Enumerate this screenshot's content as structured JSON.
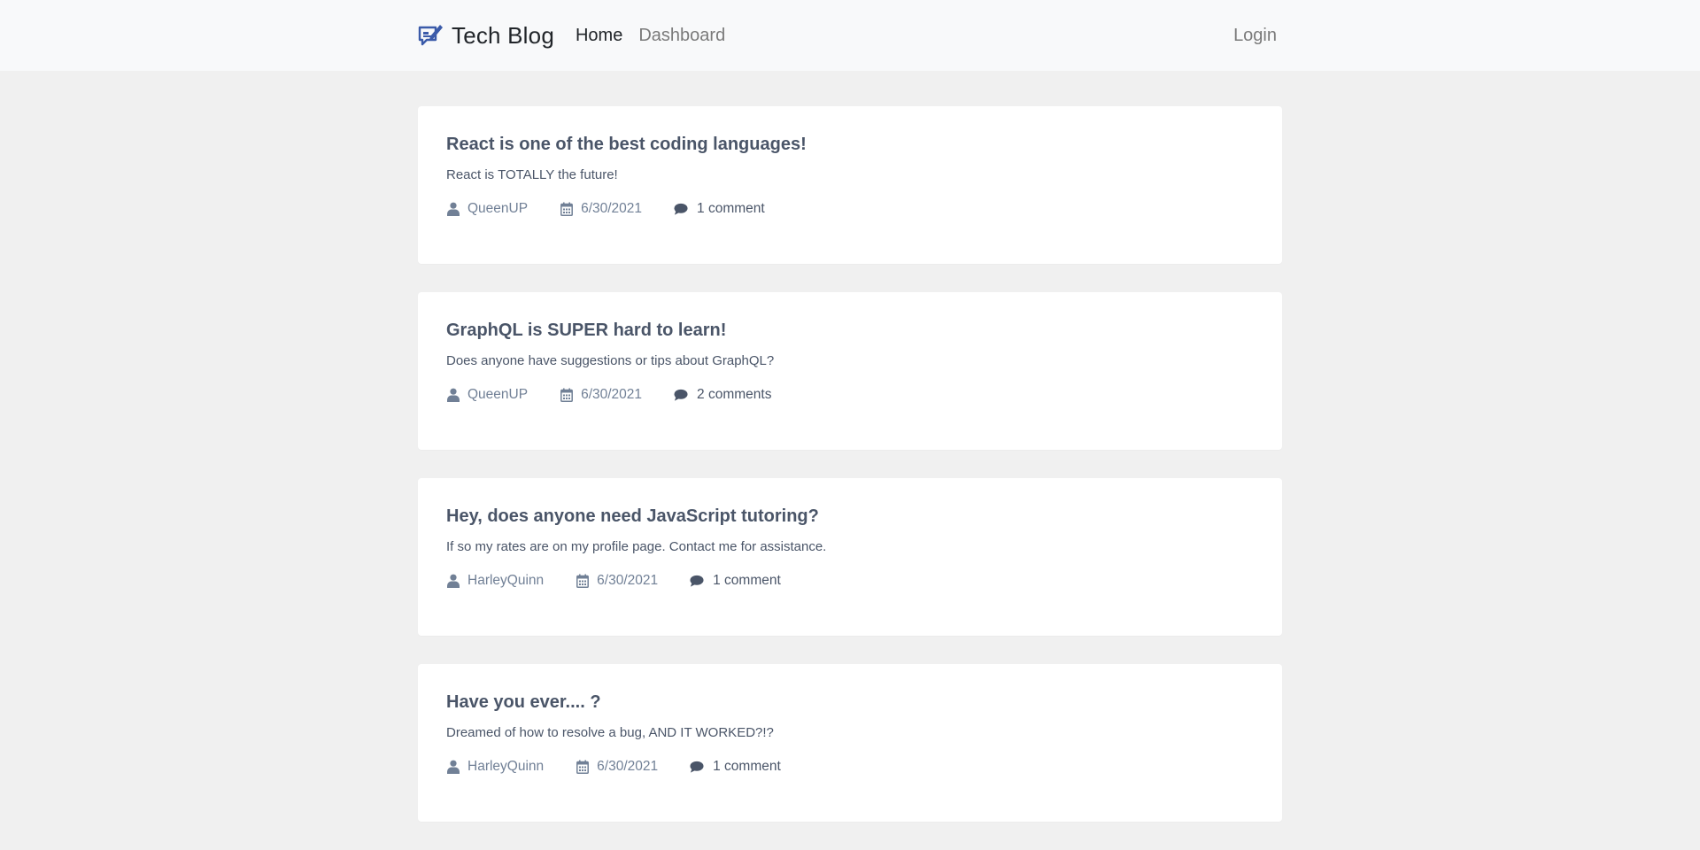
{
  "navbar": {
    "brand_title": "Tech Blog",
    "links": {
      "home": "Home",
      "dashboard": "Dashboard",
      "login": "Login"
    }
  },
  "colors": {
    "nav_bg": "#f8f9fa",
    "page_bg": "#f0f0f0",
    "card_bg": "#ffffff",
    "brand_blue": "#3b5ba9",
    "text_dark": "#4a5568",
    "text_muted": "#718096"
  },
  "icons": {
    "brand": "chat-pencil-icon",
    "author": "user-icon",
    "date": "calendar-icon",
    "comments": "comment-bubble-icon"
  },
  "posts": [
    {
      "title": "React is one of the best coding languages!",
      "body": "React is TOTALLY the future!",
      "author": "QueenUP",
      "date": "6/30/2021",
      "comments": "1 comment"
    },
    {
      "title": "GraphQL is SUPER hard to learn!",
      "body": "Does anyone have suggestions or tips about GraphQL?",
      "author": "QueenUP",
      "date": "6/30/2021",
      "comments": "2 comments"
    },
    {
      "title": "Hey, does anyone need JavaScript tutoring?",
      "body": "If so my rates are on my profile page. Contact me for assistance.",
      "author": "HarleyQuinn",
      "date": "6/30/2021",
      "comments": "1 comment"
    },
    {
      "title": "Have you ever.... ?",
      "body": "Dreamed of how to resolve a bug, AND IT WORKED?!?",
      "author": "HarleyQuinn",
      "date": "6/30/2021",
      "comments": "1 comment"
    }
  ]
}
